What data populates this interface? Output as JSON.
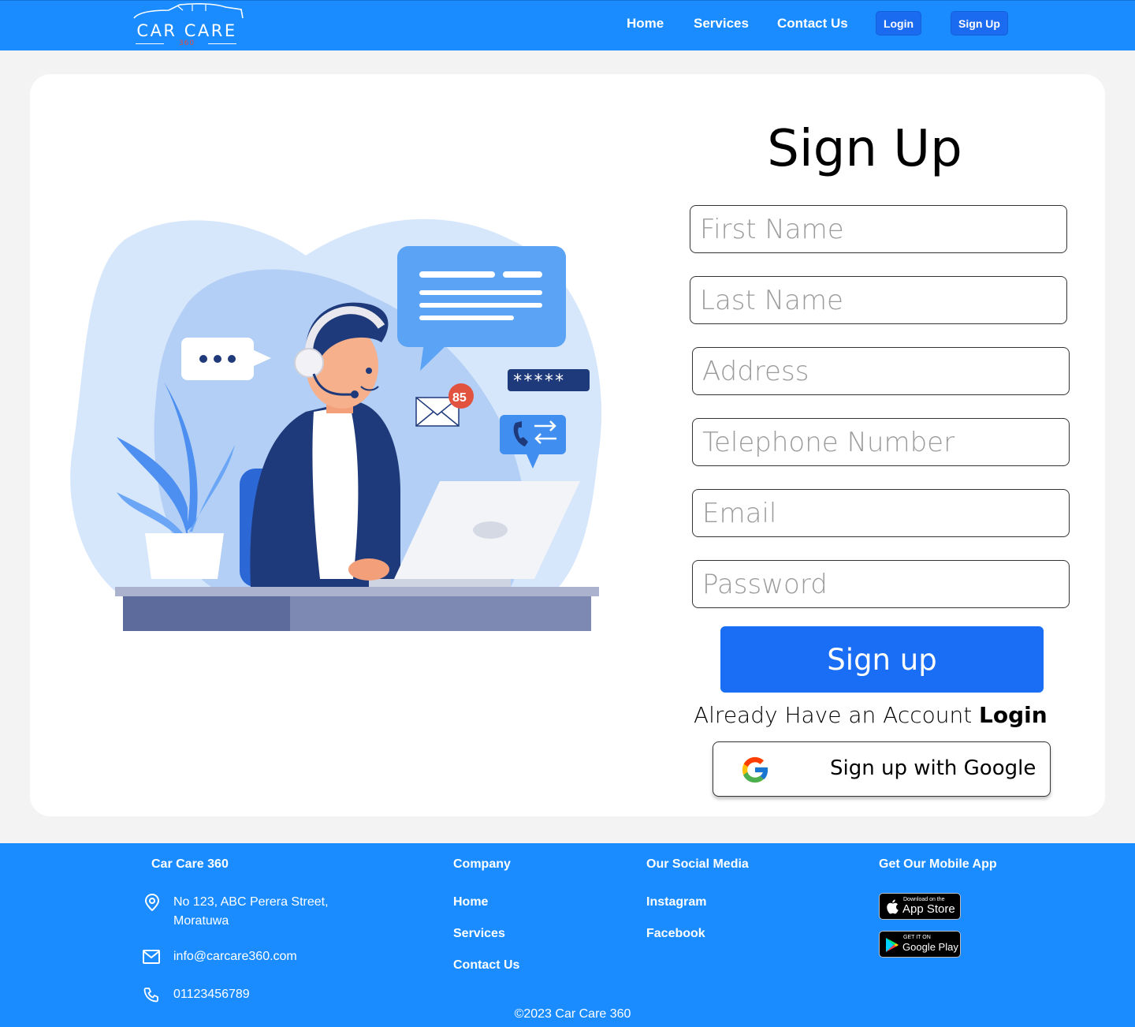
{
  "header": {
    "logo_text": "CAR CARE",
    "logo_sub": "360",
    "nav": {
      "home": "Home",
      "services": "Services",
      "contact": "Contact Us",
      "login": "Login",
      "signup": "Sign Up"
    }
  },
  "form": {
    "title": "Sign Up",
    "fields": {
      "first_name": "First Name",
      "last_name": "Last Name",
      "address": "Address",
      "telephone": "Telephone Number",
      "email": "Email",
      "password": "Password"
    },
    "submit_label": "Sign up",
    "already_text": "Already Have an Account",
    "login_label": "Login",
    "google_label": "Sign up with Google"
  },
  "illustration": {
    "badge_count": "85",
    "password_mask": "*****"
  },
  "footer": {
    "brand_heading": "Car Care 360",
    "address_line1": "No 123, ABC Perera Street,",
    "address_line2": "Moratuwa",
    "email": "info@carcare360.com",
    "phone": "01123456789",
    "company_heading": "Company",
    "company_links": [
      "Home",
      "Services",
      "Contact Us"
    ],
    "social_heading": "Our Social Media",
    "social_links": [
      "Instagram",
      "Facebook"
    ],
    "app_heading": "Get Our Mobile App",
    "app_store_small": "Download on the",
    "app_store_big": "App Store",
    "google_play_small": "GET IT ON",
    "google_play_big": "Google Play",
    "copyright": "©2023 Car Care 360"
  },
  "colors": {
    "primary": "#1a8cff",
    "button": "#1a6ef5"
  }
}
